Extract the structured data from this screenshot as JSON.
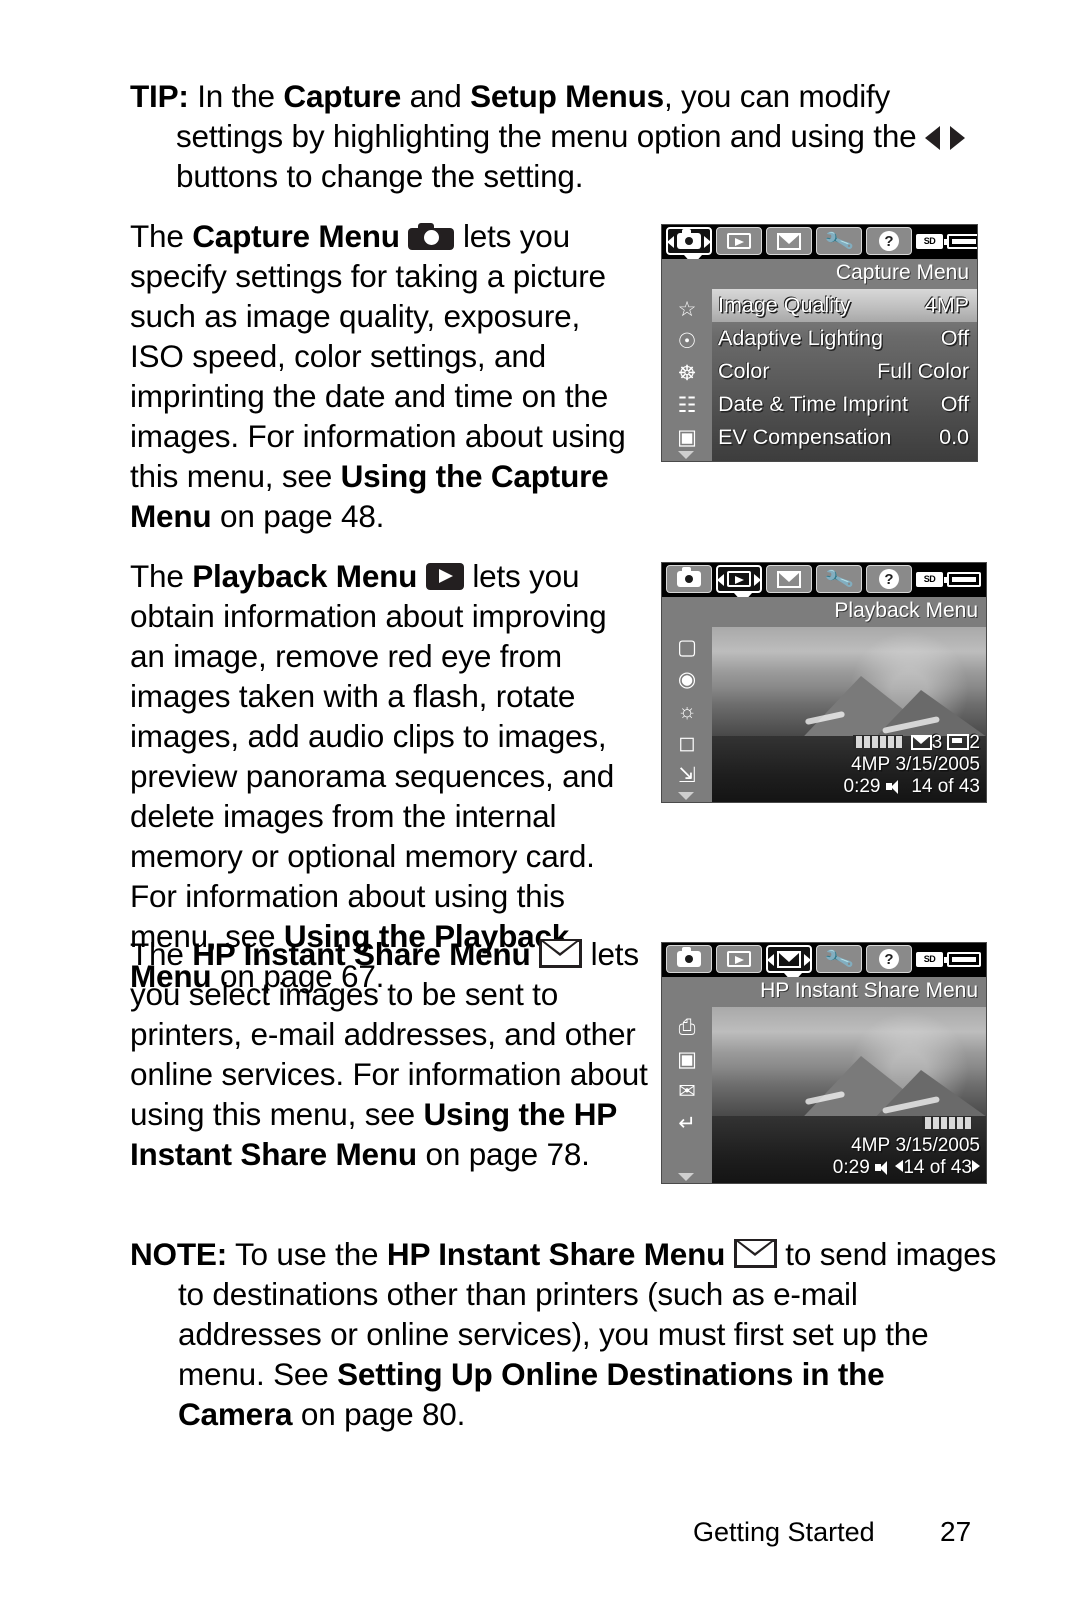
{
  "tip": {
    "label": "TIP:",
    "line1_a": " In the ",
    "line1_b": "Capture",
    "line1_c": " and ",
    "line1_d": "Setup Menus",
    "line1_e": ", you can modify",
    "line2": "settings by highlighting the menu option and using the",
    "line3_after_icon": " buttons to change the setting."
  },
  "capture_para": {
    "lead": "The ",
    "bold_title": "Capture Menu",
    "icon": "camera-icon",
    "after_icon": " lets you",
    "body": "specify settings for taking a picture such as image quality, exposure, ISO speed, color settings, and imprinting the date and time on the images. For information about using this menu, see ",
    "ref_bold": "Using the Capture Menu",
    "ref_tail": " on page 48."
  },
  "playback_para": {
    "lead": "The ",
    "bold_title": "Playback Menu",
    "icon": "play-icon",
    "after_icon": " lets you",
    "body": "obtain information about improving an image, remove red eye from images taken with a flash, rotate images, add audio clips to images, preview panorama sequences, and delete images from the internal memory or optional memory card. For information about using this menu, see ",
    "ref_bold": "Using the Playback Menu",
    "ref_tail": " on page 67."
  },
  "share_para": {
    "lead": "The ",
    "bold_title": "HP Instant Share Menu",
    "icon": "envelope-icon",
    "after_icon": " lets",
    "body": "you select images to be sent to printers, e-mail addresses, and other online services. For information about using this menu, see ",
    "ref_bold": "Using the HP Instant Share Menu",
    "ref_tail": " on page 78."
  },
  "note": {
    "label": "NOTE:",
    "seg1": " To use the ",
    "bold1": "HP Instant Share Menu",
    "icon": "envelope-icon",
    "seg2": " to send images to destinations other than printers (such as e-mail addresses or online services), you must first set up the menu. See ",
    "bold2": "Setting Up Online Destinations in the Camera",
    "seg3": " on page 80."
  },
  "footer": {
    "label": "Getting Started",
    "page": "27"
  },
  "lcd_capture": {
    "title": "Capture Menu",
    "selected_tab": "capture",
    "tabs": [
      {
        "name": "capture-tab",
        "icon": "camera-icon"
      },
      {
        "name": "playback-tab",
        "icon": "play-icon"
      },
      {
        "name": "share-tab",
        "icon": "envelope-icon"
      },
      {
        "name": "setup-tab",
        "icon": "wrench-icon"
      },
      {
        "name": "help-tab",
        "icon": "question-icon"
      }
    ],
    "status": {
      "card": "SD",
      "battery": "battery-icon"
    },
    "rows": [
      {
        "icon": "star-icon",
        "name": "Image Quality",
        "value": "4MP",
        "active": true
      },
      {
        "icon": "person-icon",
        "name": "Adaptive Lighting",
        "value": "Off",
        "active": false
      },
      {
        "icon": "palette-icon",
        "name": "Color",
        "value": "Full Color",
        "active": false
      },
      {
        "icon": "datestamp-icon",
        "name": "Date & Time Imprint",
        "value": "Off",
        "active": false
      },
      {
        "icon": "ev-icon",
        "name": "EV Compensation",
        "value": "0.0",
        "active": false
      }
    ]
  },
  "lcd_playback": {
    "title": "Playback Menu",
    "selected_tab": "playback",
    "rail_icons": [
      "delete-icon",
      "redeye-icon",
      "preview-icon",
      "panorama-icon",
      "rotate-icon"
    ],
    "overlay": {
      "share_count": "3",
      "print_count": "2",
      "resolution": "4MP",
      "date": "3/15/2005",
      "time": "0:29",
      "index": "14 of 43"
    }
  },
  "lcd_share": {
    "title": "HP Instant Share Menu",
    "selected_tab": "share",
    "rail_icons": [
      "printer-icon",
      "photos-icon",
      "setup-mail-icon",
      "back-icon"
    ],
    "overlay": {
      "resolution": "4MP",
      "date": "3/15/2005",
      "time": "0:29",
      "index": "14 of 43"
    }
  }
}
